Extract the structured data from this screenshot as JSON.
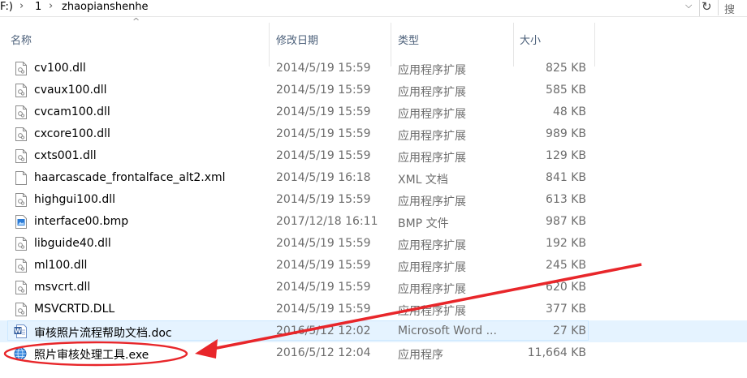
{
  "address": {
    "drive": "F:)",
    "crumbs": [
      "1",
      "zhaopianshenhe"
    ]
  },
  "columns": {
    "name": "名称",
    "date": "修改日期",
    "type": "类型",
    "size": "大小"
  },
  "files": [
    {
      "name": "cv100.dll",
      "date": "2014/5/19 15:59",
      "type": "应用程序扩展",
      "size": "825 KB",
      "icon": "dll-file-icon"
    },
    {
      "name": "cvaux100.dll",
      "date": "2014/5/19 15:59",
      "type": "应用程序扩展",
      "size": "585 KB",
      "icon": "dll-file-icon"
    },
    {
      "name": "cvcam100.dll",
      "date": "2014/5/19 15:59",
      "type": "应用程序扩展",
      "size": "48 KB",
      "icon": "dll-file-icon"
    },
    {
      "name": "cxcore100.dll",
      "date": "2014/5/19 15:59",
      "type": "应用程序扩展",
      "size": "989 KB",
      "icon": "dll-file-icon"
    },
    {
      "name": "cxts001.dll",
      "date": "2014/5/19 15:59",
      "type": "应用程序扩展",
      "size": "129 KB",
      "icon": "dll-file-icon"
    },
    {
      "name": "haarcascade_frontalface_alt2.xml",
      "date": "2014/5/19 16:18",
      "type": "XML 文档",
      "size": "841 KB",
      "icon": "xml-file-icon"
    },
    {
      "name": "highgui100.dll",
      "date": "2014/5/19 15:59",
      "type": "应用程序扩展",
      "size": "613 KB",
      "icon": "dll-file-icon"
    },
    {
      "name": "interface00.bmp",
      "date": "2017/12/18 16:11",
      "type": "BMP 文件",
      "size": "987 KB",
      "icon": "bmp-file-icon"
    },
    {
      "name": "libguide40.dll",
      "date": "2014/5/19 15:59",
      "type": "应用程序扩展",
      "size": "192 KB",
      "icon": "dll-file-icon"
    },
    {
      "name": "ml100.dll",
      "date": "2014/5/19 15:59",
      "type": "应用程序扩展",
      "size": "245 KB",
      "icon": "dll-file-icon"
    },
    {
      "name": "msvcrt.dll",
      "date": "2014/5/19 15:59",
      "type": "应用程序扩展",
      "size": "620 KB",
      "icon": "dll-file-icon"
    },
    {
      "name": "MSVCRTD.DLL",
      "date": "2014/5/19 15:59",
      "type": "应用程序扩展",
      "size": "377 KB",
      "icon": "dll-file-icon"
    },
    {
      "name": "审核照片流程帮助文档.doc",
      "date": "2016/5/12 12:02",
      "type": "Microsoft Word ...",
      "size": "27 KB",
      "icon": "word-doc-icon"
    },
    {
      "name": "照片审核处理工具.exe",
      "date": "2016/5/12 12:04",
      "type": "应用程序",
      "size": "11,664 KB",
      "icon": "exe-globe-icon"
    }
  ],
  "colors": {
    "header_text": "#4c607a",
    "annotation_red": "#e8262a",
    "hover_bg": "#e5f3ff",
    "hover_border": "#cce8ff"
  }
}
